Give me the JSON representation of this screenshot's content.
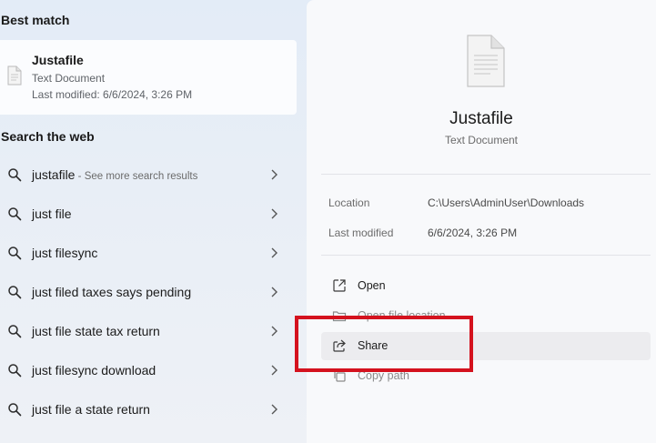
{
  "left_panel": {
    "best_match_heading": "Best match",
    "best_match": {
      "title": "Justafile",
      "type": "Text Document",
      "modified": "Last modified: 6/6/2024, 3:26 PM",
      "icon": "text-document-icon"
    },
    "web_heading": "Search the web",
    "web_items": [
      {
        "label": "justafile",
        "sub": " - See more search results"
      },
      {
        "label": "just file",
        "sub": ""
      },
      {
        "label": "just filesync",
        "sub": ""
      },
      {
        "label": "just filed taxes says pending",
        "sub": ""
      },
      {
        "label": "just file state tax return",
        "sub": ""
      },
      {
        "label": "just filesync download",
        "sub": ""
      },
      {
        "label": "just file a state return",
        "sub": ""
      }
    ]
  },
  "right_panel": {
    "title": "Justafile",
    "type": "Text Document",
    "properties": [
      {
        "label": "Location",
        "value": "C:\\Users\\AdminUser\\Downloads"
      },
      {
        "label": "Last modified",
        "value": "6/6/2024, 3:26 PM"
      }
    ],
    "actions": [
      {
        "label": "Open",
        "icon": "open-external-icon"
      },
      {
        "label": "Open file location",
        "icon": "folder-icon"
      },
      {
        "label": "Share",
        "icon": "share-icon"
      },
      {
        "label": "Copy path",
        "icon": "copy-icon"
      }
    ]
  },
  "colors": {
    "highlight_box": "#d4121e",
    "panel_background": "#f8f9fb"
  }
}
